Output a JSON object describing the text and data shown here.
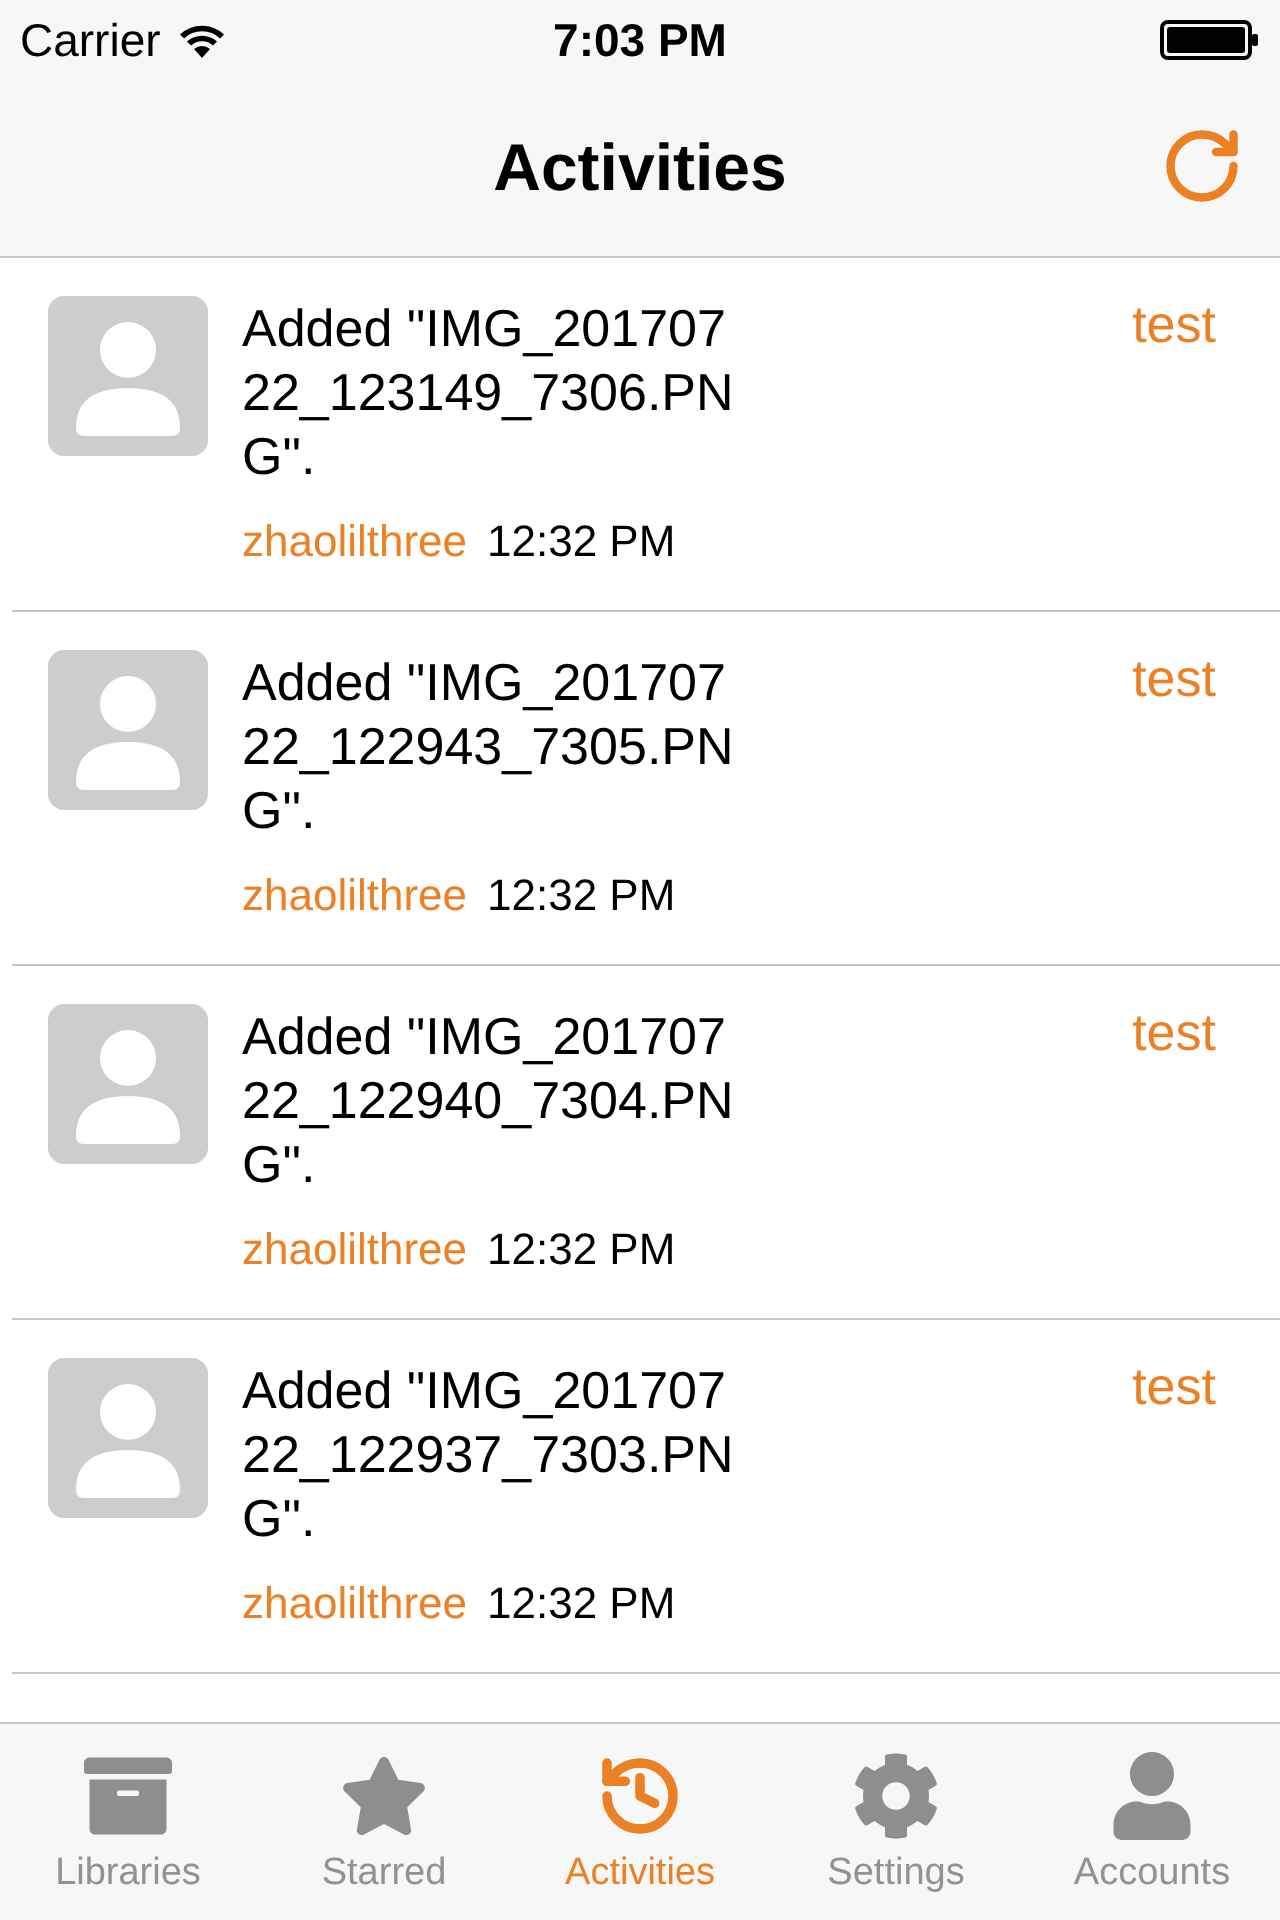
{
  "status_bar": {
    "carrier": "Carrier",
    "time": "7:03 PM"
  },
  "nav": {
    "title": "Activities"
  },
  "activities": [
    {
      "lines": [
        "Added \"IMG_201707",
        "22_123149_7306.PN",
        "G\"."
      ],
      "repo": "test",
      "user": "zhaolilthree",
      "time": "12:32 PM"
    },
    {
      "lines": [
        "Added \"IMG_201707",
        "22_122943_7305.PN",
        "G\"."
      ],
      "repo": "test",
      "user": "zhaolilthree",
      "time": "12:32 PM"
    },
    {
      "lines": [
        "Added \"IMG_201707",
        "22_122940_7304.PN",
        "G\"."
      ],
      "repo": "test",
      "user": "zhaolilthree",
      "time": "12:32 PM"
    },
    {
      "lines": [
        "Added \"IMG_201707",
        "22_122937_7303.PN",
        "G\"."
      ],
      "repo": "test",
      "user": "zhaolilthree",
      "time": "12:32 PM"
    }
  ],
  "tabs": [
    {
      "kind": "libraries",
      "label": "Libraries",
      "selected": false
    },
    {
      "kind": "starred",
      "label": "Starred",
      "selected": false
    },
    {
      "kind": "activities",
      "label": "Activities",
      "selected": true
    },
    {
      "kind": "settings",
      "label": "Settings",
      "selected": false
    },
    {
      "kind": "accounts",
      "label": "Accounts",
      "selected": false
    }
  ]
}
